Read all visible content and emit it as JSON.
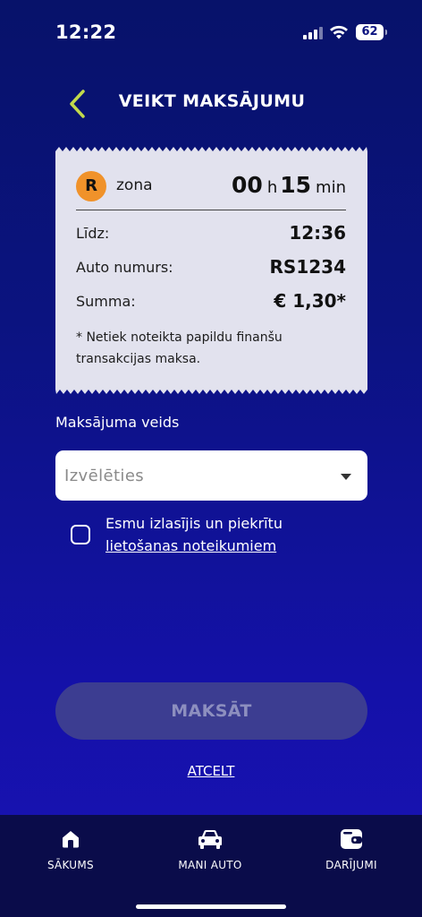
{
  "status_bar": {
    "time": "12:22",
    "battery": "62"
  },
  "header": {
    "title": "VEIKT MAKSĀJUMU"
  },
  "receipt": {
    "zone_letter": "R",
    "zone_label": "zona",
    "duration_hours": "00",
    "hours_unit": "h",
    "duration_minutes": "15",
    "minutes_unit": "min",
    "rows": [
      {
        "label": "Līdz:",
        "value": "12:36"
      },
      {
        "label": "Auto numurs:",
        "value": "RS1234"
      },
      {
        "label": "Summa:",
        "value": "€ 1,30*"
      }
    ],
    "note": "* Netiek noteikta papildu finanšu transakcijas maksa.",
    "zone_color": "#f0922a"
  },
  "payment": {
    "label": "Maksājuma veids",
    "placeholder": "Izvēlēties"
  },
  "terms": {
    "text": "Esmu izlasījis un piekrītu",
    "link": "lietošanas noteikumiem"
  },
  "pay_button": "MAKSĀT",
  "cancel": "ATCELT",
  "tabs": [
    {
      "label": "SĀKUMS",
      "icon": "home-icon"
    },
    {
      "label": "MANI AUTO",
      "icon": "car-icon"
    },
    {
      "label": "DARĪJUMI",
      "icon": "wallet-icon"
    }
  ],
  "colors": {
    "accent": "#c2d94c",
    "background": "#0b1380",
    "tabbar": "#0a0c4a",
    "card": "#e2e2ee"
  }
}
